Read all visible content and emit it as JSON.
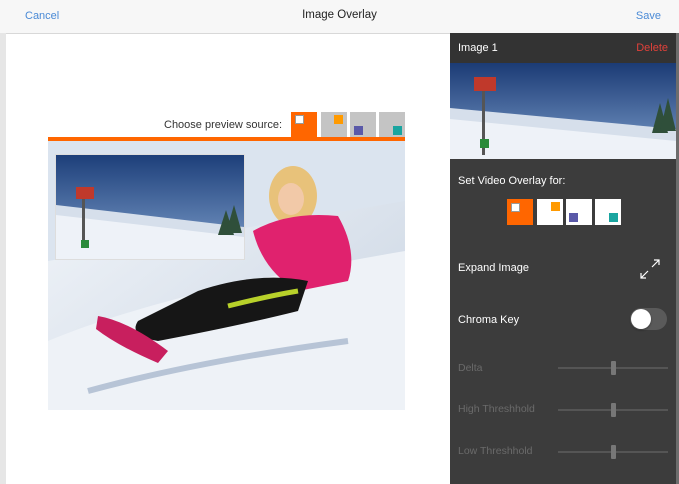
{
  "nav": {
    "cancel_label": "Cancel",
    "title": "Image Overlay",
    "save_label": "Save"
  },
  "preview": {
    "source_label": "Choose preview source:",
    "selected_source_index": 0
  },
  "panel": {
    "title": "Image 1",
    "delete_label": "Delete",
    "overlay_label": "Set Video Overlay for:",
    "selected_overlay_index": 0,
    "expand_label": "Expand Image",
    "chroma_label": "Chroma Key",
    "chroma_on": false,
    "sliders": [
      {
        "label": "Delta",
        "value": 0.5
      },
      {
        "label": "High Threshhold",
        "value": 0.5
      },
      {
        "label": "Low Threshhold",
        "value": 0.5
      }
    ]
  },
  "colors": {
    "accent": "#ff6600",
    "link": "#4a8ad6",
    "delete": "#e0413a",
    "panel_bg": "#3c3c3c"
  },
  "icons": [
    "expand-icon"
  ]
}
